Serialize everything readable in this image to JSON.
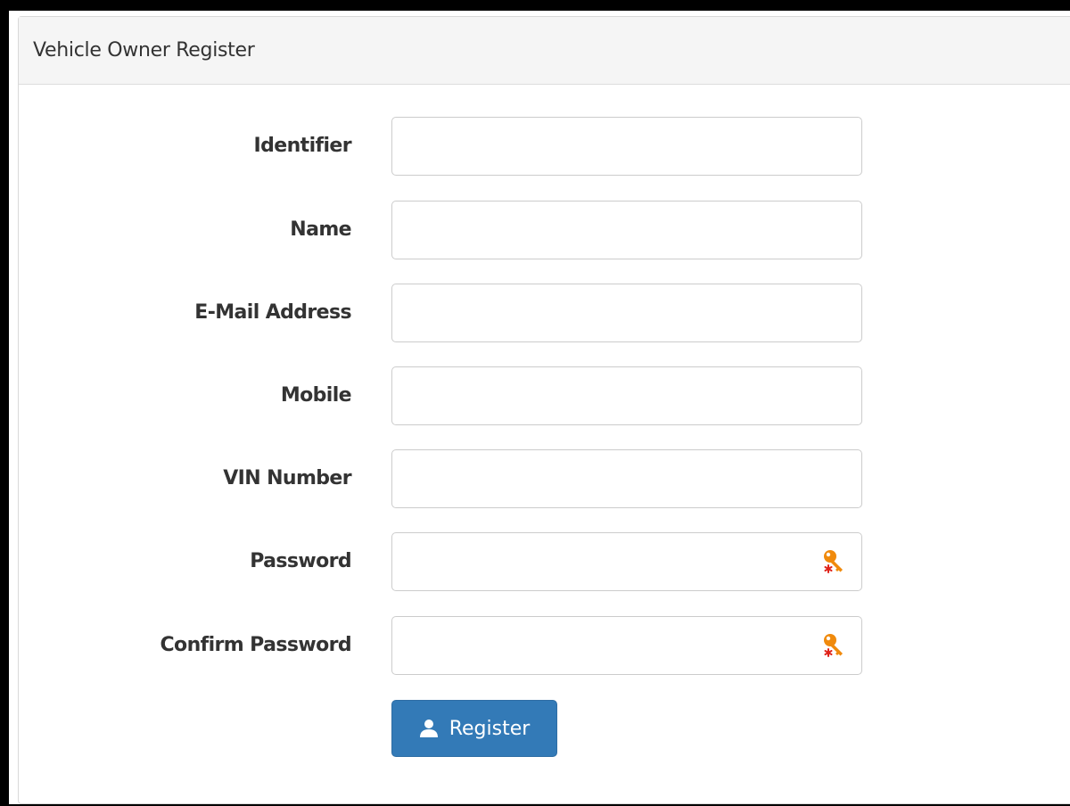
{
  "panel": {
    "title": "Vehicle Owner Register"
  },
  "form": {
    "fields": [
      {
        "label": "Identifier",
        "value": "",
        "type": "text"
      },
      {
        "label": "Name",
        "value": "",
        "type": "text"
      },
      {
        "label": "E-Mail Address",
        "value": "",
        "type": "email"
      },
      {
        "label": "Mobile",
        "value": "",
        "type": "text"
      },
      {
        "label": "VIN Number",
        "value": "",
        "type": "text"
      },
      {
        "label": "Password",
        "value": "",
        "type": "password",
        "icon": "password-key-icon"
      },
      {
        "label": "Confirm Password",
        "value": "",
        "type": "password",
        "icon": "password-key-icon"
      }
    ],
    "submit_label": "Register",
    "submit_icon": "user-icon"
  },
  "colors": {
    "primary": "#337ab7",
    "heading_bg": "#f5f5f5",
    "key_icon": "#f08a0c",
    "key_asterisk": "#e0241b"
  }
}
